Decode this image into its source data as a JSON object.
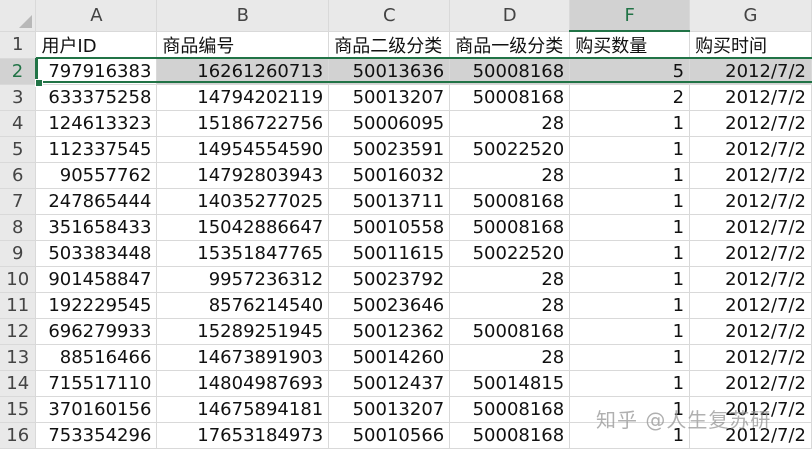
{
  "sheet": {
    "column_headers": [
      "A",
      "B",
      "C",
      "D",
      "F",
      "G"
    ],
    "active_column": "F",
    "active_row": "2",
    "header_row": {
      "row_number": "1",
      "cells": [
        "用户ID",
        "商品编号",
        "商品二级分类",
        "商品一级分类",
        "购买数量",
        "购买时间"
      ]
    },
    "rows": [
      {
        "n": "2",
        "cells": [
          "797916383",
          "16261260713",
          "50013636",
          "50008168",
          "5",
          "2012/7/2"
        ]
      },
      {
        "n": "3",
        "cells": [
          "633375258",
          "14794202119",
          "50013207",
          "50008168",
          "2",
          "2012/7/2"
        ]
      },
      {
        "n": "4",
        "cells": [
          "124613323",
          "15186722756",
          "50006095",
          "28",
          "1",
          "2012/7/2"
        ]
      },
      {
        "n": "5",
        "cells": [
          "112337545",
          "14954554590",
          "50023591",
          "50022520",
          "1",
          "2012/7/2"
        ]
      },
      {
        "n": "6",
        "cells": [
          "90557762",
          "14792803943",
          "50016032",
          "28",
          "1",
          "2012/7/2"
        ]
      },
      {
        "n": "7",
        "cells": [
          "247865444",
          "14035277025",
          "50013711",
          "50008168",
          "1",
          "2012/7/2"
        ]
      },
      {
        "n": "8",
        "cells": [
          "351658433",
          "15042886647",
          "50010558",
          "50008168",
          "1",
          "2012/7/2"
        ]
      },
      {
        "n": "9",
        "cells": [
          "503383448",
          "15351847765",
          "50011615",
          "50022520",
          "1",
          "2012/7/2"
        ]
      },
      {
        "n": "10",
        "cells": [
          "901458847",
          "9957236312",
          "50023792",
          "28",
          "1",
          "2012/7/2"
        ]
      },
      {
        "n": "11",
        "cells": [
          "192229545",
          "8576214540",
          "50023646",
          "28",
          "1",
          "2012/7/2"
        ]
      },
      {
        "n": "12",
        "cells": [
          "696279933",
          "15289251945",
          "50012362",
          "50008168",
          "1",
          "2012/7/2"
        ]
      },
      {
        "n": "13",
        "cells": [
          "88516466",
          "14673891903",
          "50014260",
          "28",
          "1",
          "2012/7/2"
        ]
      },
      {
        "n": "14",
        "cells": [
          "715517110",
          "14804987693",
          "50012437",
          "50014815",
          "1",
          "2012/7/2"
        ]
      },
      {
        "n": "15",
        "cells": [
          "370160156",
          "14675894181",
          "50013207",
          "50008168",
          "1",
          "2012/7/2"
        ]
      },
      {
        "n": "16",
        "cells": [
          "753354296",
          "17653184973",
          "50010566",
          "50008168",
          "1",
          "2012/7/2"
        ]
      }
    ]
  },
  "watermark": "知乎 @人生复苏研"
}
